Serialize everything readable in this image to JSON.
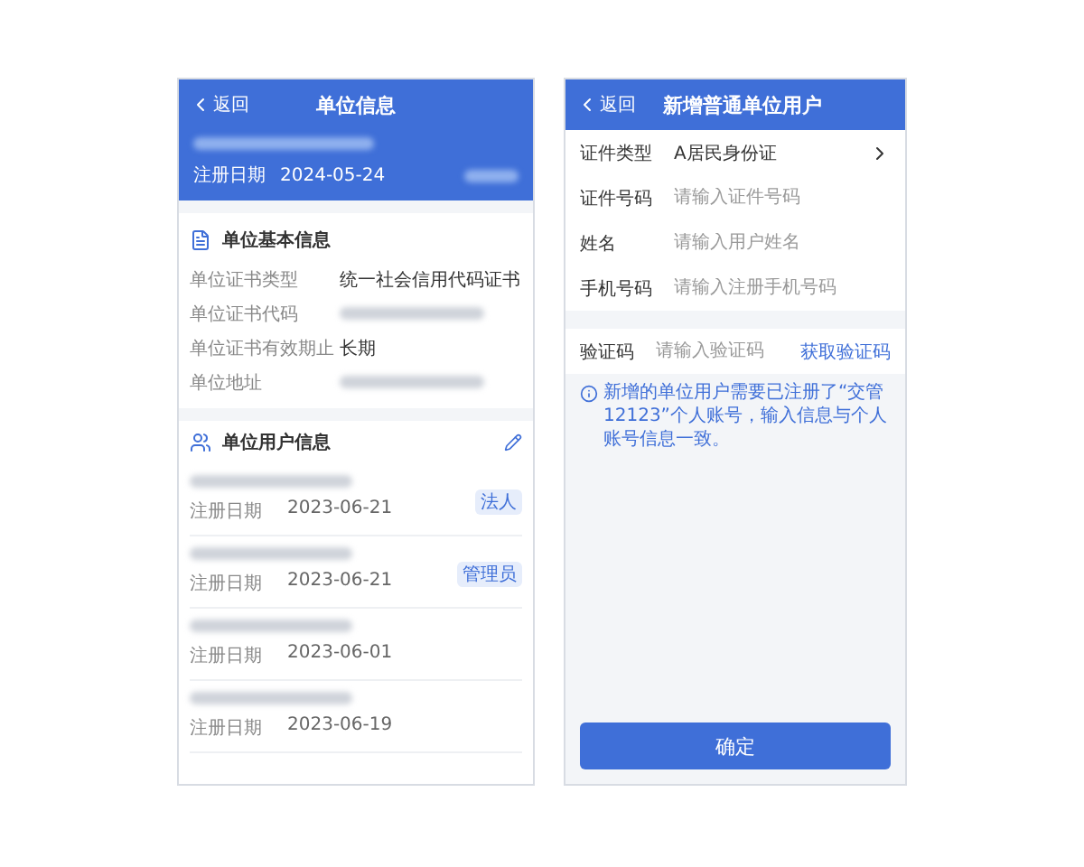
{
  "unit_info_screen": {
    "header": {
      "back": "返回",
      "title": "单位信息"
    },
    "registration": {
      "label": "注册日期",
      "date": "2024-05-24"
    },
    "basic_info": {
      "title": "单位基本信息",
      "rows": [
        {
          "label": "单位证书类型",
          "value": "统一社会信用代码证书"
        },
        {
          "label": "单位证书代码"
        },
        {
          "label": "单位证书有效期止",
          "value": "长期"
        },
        {
          "label": "单位地址"
        }
      ]
    },
    "users": {
      "title": "单位用户信息",
      "items": [
        {
          "date_label": "注册日期",
          "date": "2023-06-21",
          "tag": "法人"
        },
        {
          "date_label": "注册日期",
          "date": "2023-06-21",
          "tag": "管理员"
        },
        {
          "date_label": "注册日期",
          "date": "2023-06-01"
        },
        {
          "date_label": "注册日期",
          "date": "2023-06-19"
        }
      ]
    }
  },
  "add_user_screen": {
    "header": {
      "back": "返回",
      "title": "新增普通单位用户"
    },
    "fields": [
      {
        "kind": "select",
        "label": "证件类型",
        "value": "A居民身份证"
      },
      {
        "kind": "input",
        "label": "证件号码",
        "placeholder": "请输入证件号码"
      },
      {
        "kind": "input",
        "label": "姓名",
        "placeholder": "请输入用户姓名"
      },
      {
        "kind": "input",
        "label": "手机号码",
        "placeholder": "请输入注册手机号码"
      }
    ],
    "verification": {
      "label": "验证码",
      "placeholder": "请输入验证码",
      "link": "获取验证码"
    },
    "notice": "新增的单位用户需要已注册了“交管12123”个人账号，输入信息与个人账号信息一致。",
    "confirm": "确定"
  }
}
